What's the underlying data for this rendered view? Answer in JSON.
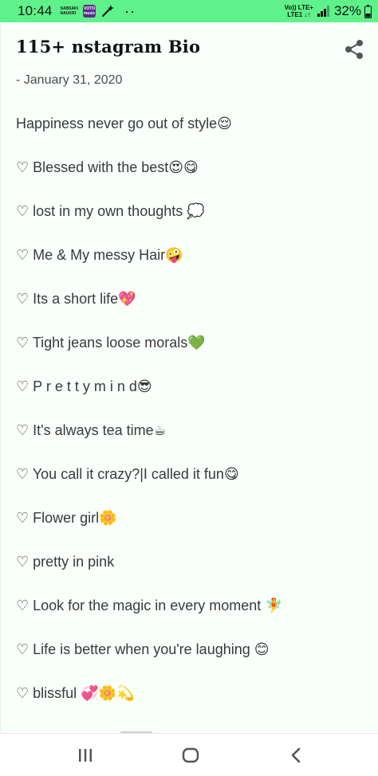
{
  "status_bar": {
    "time": "10:44",
    "carrier_small_1": "SABSAKI",
    "carrier_small_2": "NAUKRI",
    "app_badge_1": "VOTO",
    "app_badge_2": "music",
    "volte_top": "Vo)) LTE+",
    "volte_bottom": "LTE1 ↓↑",
    "battery": "32%",
    "accent_color": "#5ff28a",
    "icons": [
      "wand-icon",
      "more-dots-icon",
      "signal-icon",
      "battery-icon"
    ]
  },
  "post": {
    "title": "115+ nstagram Bio",
    "date": "- January 31, 2020",
    "share_icon": "share-icon",
    "bios": [
      "Happiness never go out of style😌",
      "♡ Blessed with the best😍😋",
      "♡ lost in my own thoughts 💭",
      "♡ Me & My messy Hair🤪",
      "♡ Its a short life💖",
      "♡ Tight jeans loose morals💚",
      "♡ P r e t t y  m i n d😎",
      "♡ It's always tea time☕",
      "♡ You call it crazy?|I called it fun😋",
      "♡ Flower girl🌼",
      "♡ pretty in pink",
      "♡ Look for the magic in every moment 🧚",
      "♡ Life is better when you're laughing 😊",
      "♡ blissful 💞🌼💫"
    ]
  },
  "nav_bar": {
    "icons": [
      "recents-icon",
      "home-icon",
      "back-icon"
    ]
  }
}
